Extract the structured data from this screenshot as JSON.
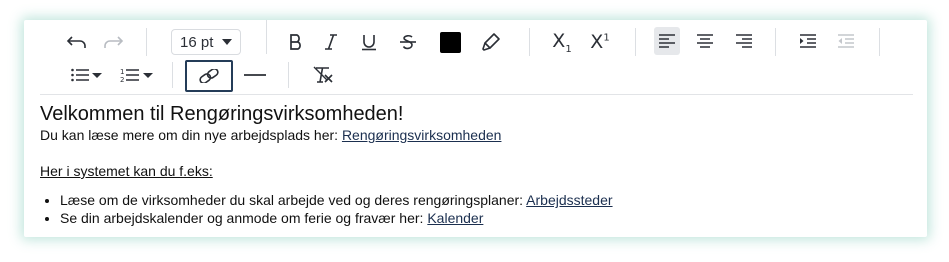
{
  "toolbar": {
    "font_size_value": "16 pt",
    "subscript_label": "X",
    "subscript_sub": "1",
    "superscript_label": "X",
    "superscript_sup": "1",
    "text_color": "#000000",
    "active_align": "left",
    "link_focus_color": "#243c58"
  },
  "content": {
    "heading": "Velkommen til Rengøringsvirksomheden!",
    "intro_text": "Du kan læse mere om din nye arbejdsplads her: ",
    "intro_link": "Rengøringsvirksomheden",
    "section_heading": "Her i systemet kan du f.eks:",
    "list": [
      {
        "text": "Læse om de virksomheder du skal arbejde ved og deres rengøringsplaner: ",
        "link": "Arbejdssteder "
      },
      {
        "text": "Se din arbejdskalender og anmode om ferie og fravær her: ",
        "link": "Kalender"
      }
    ]
  },
  "colors": {
    "card_glow": "#78c8b4",
    "link": "#1b2f4f",
    "active_button_bg": "#e6e8eb"
  }
}
